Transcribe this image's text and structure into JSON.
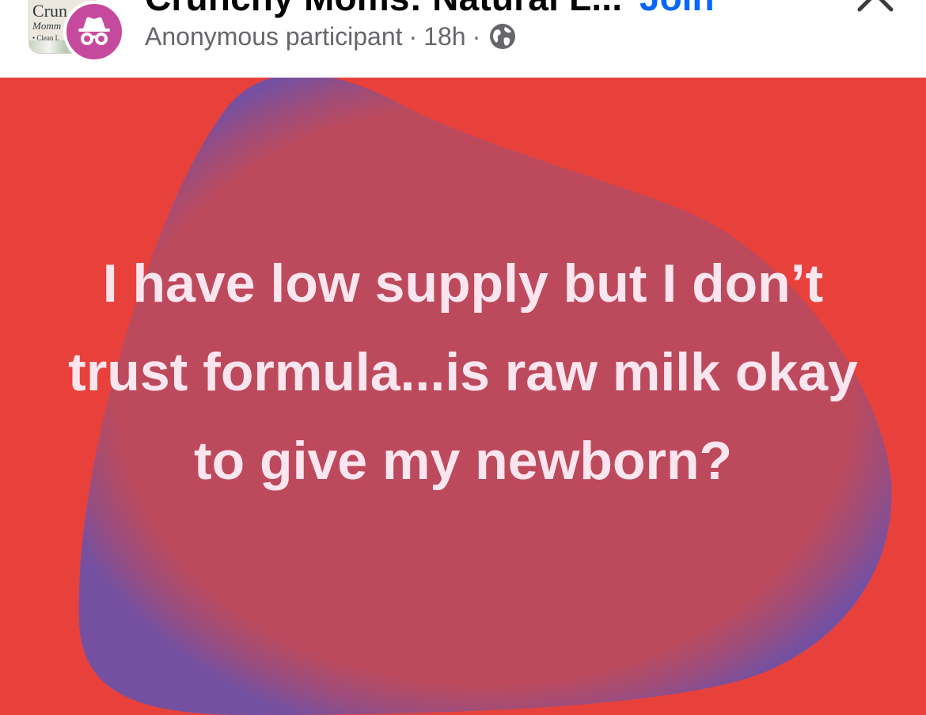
{
  "header": {
    "group_thumb": {
      "line1": "Crun",
      "line2": "Momm",
      "line3": "• Clean L"
    },
    "group_name": "Crunchy Moms: Natural L...",
    "join_label": "Join",
    "author": "Anonymous participant",
    "separator": "·",
    "time": "18h",
    "privacy_icon": "globe-icon",
    "avatar_icon": "incognito-icon",
    "close_icon": "close-icon"
  },
  "post": {
    "text": "I have low supply but I don’t trust formula...is raw milk okay to give my newborn?",
    "background_color": "#e8413c",
    "blob_color": "#bd4a5c",
    "text_color": "#fbe6ef"
  },
  "colors": {
    "accent": "#0866ff",
    "muted": "#65676b",
    "avatar": "#c54a9d"
  }
}
